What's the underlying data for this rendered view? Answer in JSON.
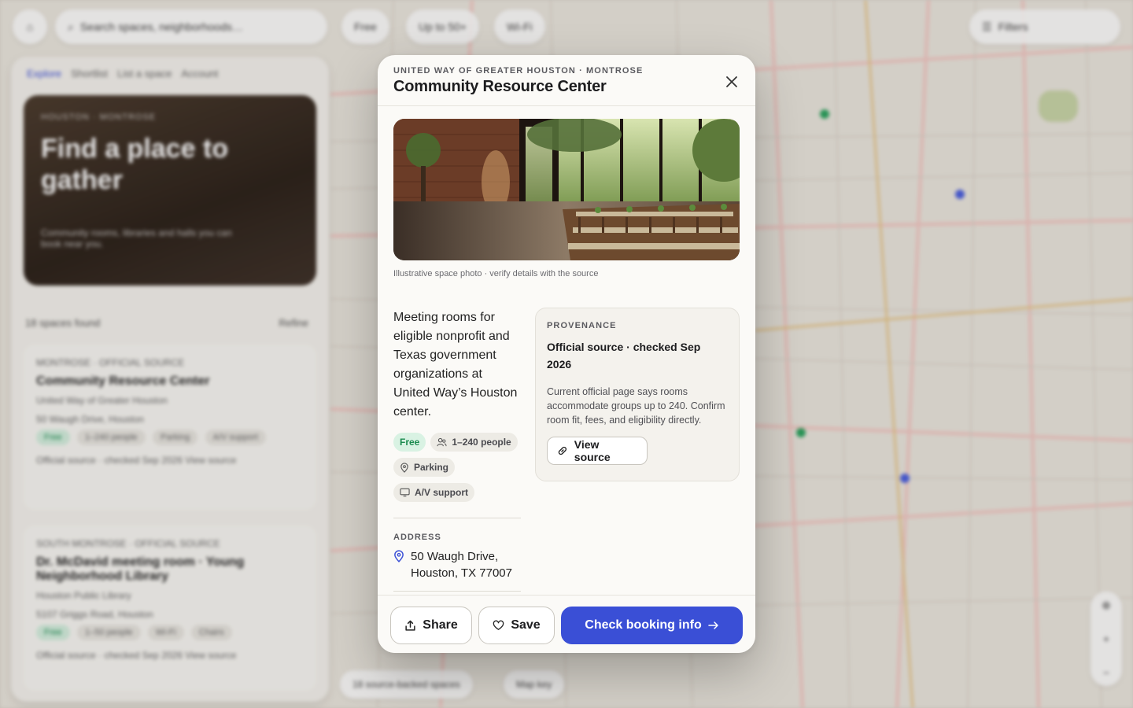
{
  "background": {
    "search_placeholder": "Search spaces, neighborhoods…",
    "filter_chips": [
      "Free",
      "Up to 50+",
      "Wi-Fi"
    ],
    "filters_label": "Filters",
    "panel_tabs": [
      "Explore",
      "Shortlist",
      "List a space",
      "Account"
    ],
    "hero_kicker": "HOUSTON · MONTROSE",
    "hero_title": "Find a place to gather",
    "hero_sub": "Community rooms, libraries and halls you can book near you.",
    "results_count": "18 spaces found",
    "refine_label": "Refine",
    "cards": [
      {
        "kicker": "MONTROSE · OFFICIAL SOURCE",
        "title": "Community Resource Center",
        "org": "United Way of Greater Houston",
        "addr": "50 Waugh Drive, Houston",
        "chips": [
          "Free",
          "1–240 people",
          "Parking",
          "A/V support"
        ],
        "source": "Official source · checked Sep 2026",
        "link": "View source"
      },
      {
        "kicker": "SOUTH MONTROSE · OFFICIAL SOURCE",
        "title": "Dr. McDavid meeting room · Young Neighborhood Library",
        "org": "Houston Public Library",
        "addr": "5107 Griggs Road, Houston",
        "chips": [
          "Free",
          "1–50 people",
          "Wi-Fi",
          "Chairs"
        ],
        "source": "Official source · checked Sep 2026",
        "link": "View source"
      }
    ],
    "map_footer_chips": [
      "18 source-backed spaces",
      "Map key"
    ]
  },
  "modal": {
    "kicker": "UNITED WAY OF GREATER HOUSTON · MONTROSE",
    "title": "Community Resource Center",
    "photo_caption": "Illustrative space photo · verify details with the source",
    "description": "Meeting rooms for eligible nonprofit and Texas government organizations at United Way’s Houston center.",
    "chips": {
      "price": "Free",
      "capacity": "1–240 people",
      "parking": "Parking",
      "av": "A/V support"
    },
    "address_label": "ADDRESS",
    "address_line1": "50 Waugh Drive,",
    "address_line2": "Houston, TX 77007",
    "provenance": {
      "label": "PROVENANCE",
      "title": "Official source · checked Sep 2026",
      "body": "Current official page says rooms accommodate groups up to 240. Confirm room fit, fees, and eligibility directly.",
      "button": "View source"
    },
    "footer": {
      "share": "Share",
      "save": "Save",
      "primary": "Check booking info"
    }
  },
  "colors": {
    "accent": "#3a4fd6",
    "free_bg": "#d9f2e3",
    "free_text": "#1a8a4e"
  }
}
